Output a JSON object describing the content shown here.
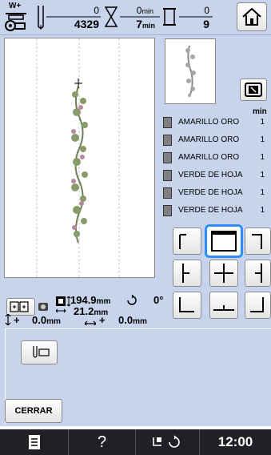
{
  "topbar": {
    "tension_label": "W+",
    "stitches_done": "0",
    "stitches_total": "4329",
    "time_done": "0",
    "time_total": "7",
    "time_unit": "min",
    "colors_done": "0",
    "colors_total": "9"
  },
  "threads": {
    "min_header": "min",
    "rows": [
      {
        "name": "AMARILLO ORO",
        "count": "1",
        "color": "#808080"
      },
      {
        "name": "AMARILLO ORO",
        "count": "1",
        "color": "#808080"
      },
      {
        "name": "AMARILLO ORO",
        "count": "1",
        "color": "#808080"
      },
      {
        "name": "VERDE DE HOJA",
        "count": "1",
        "color": "#808080"
      },
      {
        "name": "VERDE DE HOJA",
        "count": "1",
        "color": "#808080"
      },
      {
        "name": "VERDE DE HOJA",
        "count": "1",
        "color": "#808080"
      }
    ]
  },
  "info": {
    "width": "194.9",
    "height": "21.2",
    "unit": "mm",
    "rotation": "0",
    "degree_sign": "°",
    "offset_y_sign": "+",
    "offset_y": "0.0",
    "offset_x_sign": "+",
    "offset_x": "0.0"
  },
  "buttons": {
    "close_label": "CERRAR"
  },
  "bottombar": {
    "help": "?",
    "clock": "12:00"
  },
  "colors": {
    "panel": "#c7d4ec",
    "selection": "#2f8dff",
    "bottombar": "#1f2124"
  }
}
